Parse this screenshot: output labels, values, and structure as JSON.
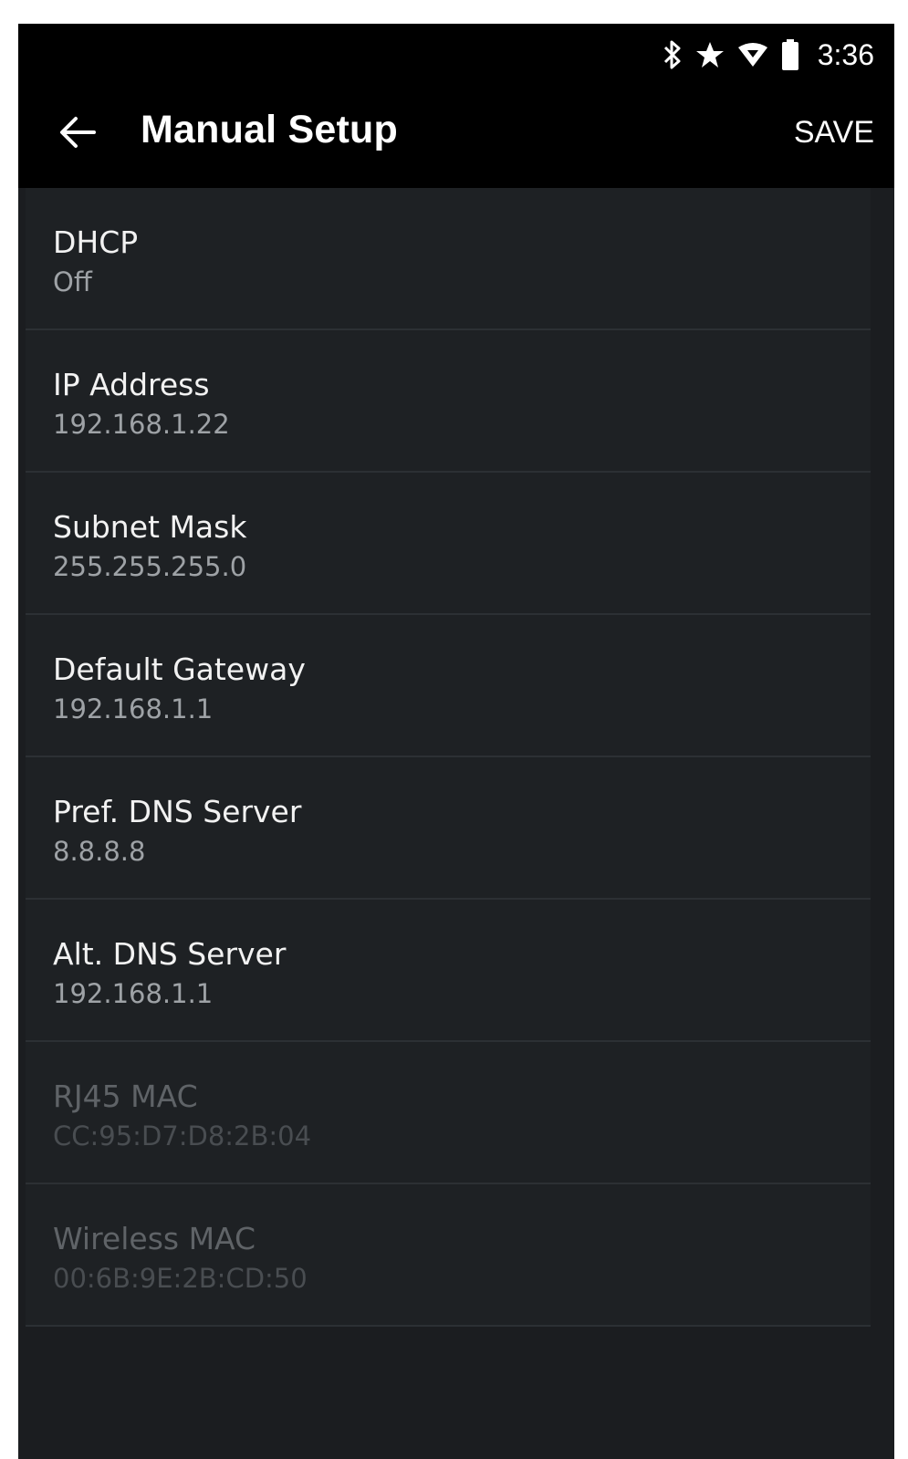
{
  "status_bar": {
    "time": "3:36",
    "icons": [
      "bluetooth-icon",
      "star-icon",
      "wifi-icon",
      "battery-icon"
    ]
  },
  "toolbar": {
    "title": "Manual Setup",
    "save_label": "SAVE",
    "back_icon": "back-arrow-icon"
  },
  "settings": [
    {
      "label": "DHCP",
      "value": "Off",
      "enabled": true
    },
    {
      "label": "IP Address",
      "value": "192.168.1.22",
      "enabled": true
    },
    {
      "label": "Subnet Mask",
      "value": "255.255.255.0",
      "enabled": true
    },
    {
      "label": "Default Gateway",
      "value": "192.168.1.1",
      "enabled": true
    },
    {
      "label": "Pref. DNS Server",
      "value": "8.8.8.8",
      "enabled": true
    },
    {
      "label": "Alt. DNS Server",
      "value": "192.168.1.1",
      "enabled": true
    },
    {
      "label": "RJ45 MAC",
      "value": "CC:95:D7:D8:2B:04",
      "enabled": false
    },
    {
      "label": "Wireless MAC",
      "value": "00:6B:9E:2B:CD:50",
      "enabled": false
    }
  ],
  "colors": {
    "app_bar": "#000000",
    "list_background": "#1e2124",
    "primary_text": "#f2f2f2",
    "secondary_text": "#9ea2a6",
    "disabled_text": "#5f6367"
  }
}
